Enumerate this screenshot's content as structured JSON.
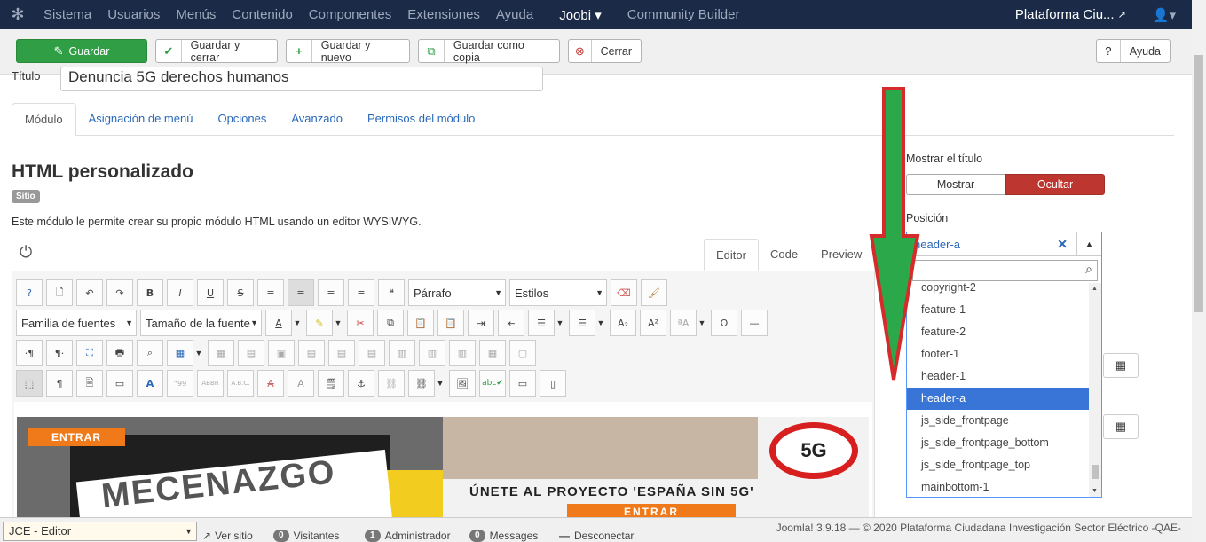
{
  "topnav": {
    "menu": [
      "Sistema",
      "Usuarios",
      "Menús",
      "Contenido",
      "Componentes",
      "Extensiones",
      "Ayuda",
      "Joobi ▾",
      "Community Builder"
    ],
    "site_name": "Plataforma Ciu..."
  },
  "toolbar": {
    "save": "Guardar",
    "save_close": "Guardar y cerrar",
    "save_new": "Guardar y nuevo",
    "save_copy": "Guardar como copia",
    "close": "Cerrar",
    "help": "Ayuda"
  },
  "form": {
    "title_label": "Título",
    "title_value": "Denuncia 5G derechos humanos"
  },
  "tabs": [
    "Módulo",
    "Asignación de menú",
    "Opciones",
    "Avanzado",
    "Permisos del módulo"
  ],
  "module": {
    "heading": "HTML personalizado",
    "badge": "Sitio",
    "description": "Este módulo le permite crear su propio módulo HTML usando un editor WYSIWYG."
  },
  "editor": {
    "tabs": [
      "Editor",
      "Code",
      "Preview"
    ],
    "format_select": "Párrafo",
    "styles_select": "Estilos",
    "font_family": "Familia de fuentes",
    "font_size": "Tamaño de la fuente",
    "banner_left_button": "ENTRAR",
    "banner_left_text": "MECENAZGO",
    "banner_right_text": "ÚNETE AL PROYECTO 'ESPAÑA SIN 5G'",
    "banner_right_button": "ENTRAR",
    "banner_badge": "5G"
  },
  "right_panel": {
    "show_title_label": "Mostrar el título",
    "show": "Mostrar",
    "hide": "Ocultar",
    "position_label": "Posición",
    "position_value": "header-a",
    "options": [
      "copyright-2",
      "feature-1",
      "feature-2",
      "footer-1",
      "header-1",
      "header-a",
      "js_side_frontpage",
      "js_side_frontpage_bottom",
      "js_side_frontpage_top",
      "mainbottom-1"
    ],
    "selected_index": 5
  },
  "status": {
    "editor_select": "JCE - Editor",
    "view_site": "Ver sitio",
    "visitors_count": "0",
    "visitors": "Visitantes",
    "admin_count": "1",
    "admin": "Administrador",
    "messages_count": "0",
    "messages": "Messages",
    "logout": "Desconectar",
    "copyright": "Joomla! 3.9.18 — © 2020 Plataforma Ciudadana Investigación Sector Eléctrico -QAE-"
  },
  "colors": {
    "nav_bg": "#1a2a47",
    "save_green": "#2f9e44",
    "hide_red": "#bd362f",
    "selected_blue": "#3875d7",
    "arrow_green": "#2aa84a",
    "arrow_red": "#d62b2b"
  }
}
